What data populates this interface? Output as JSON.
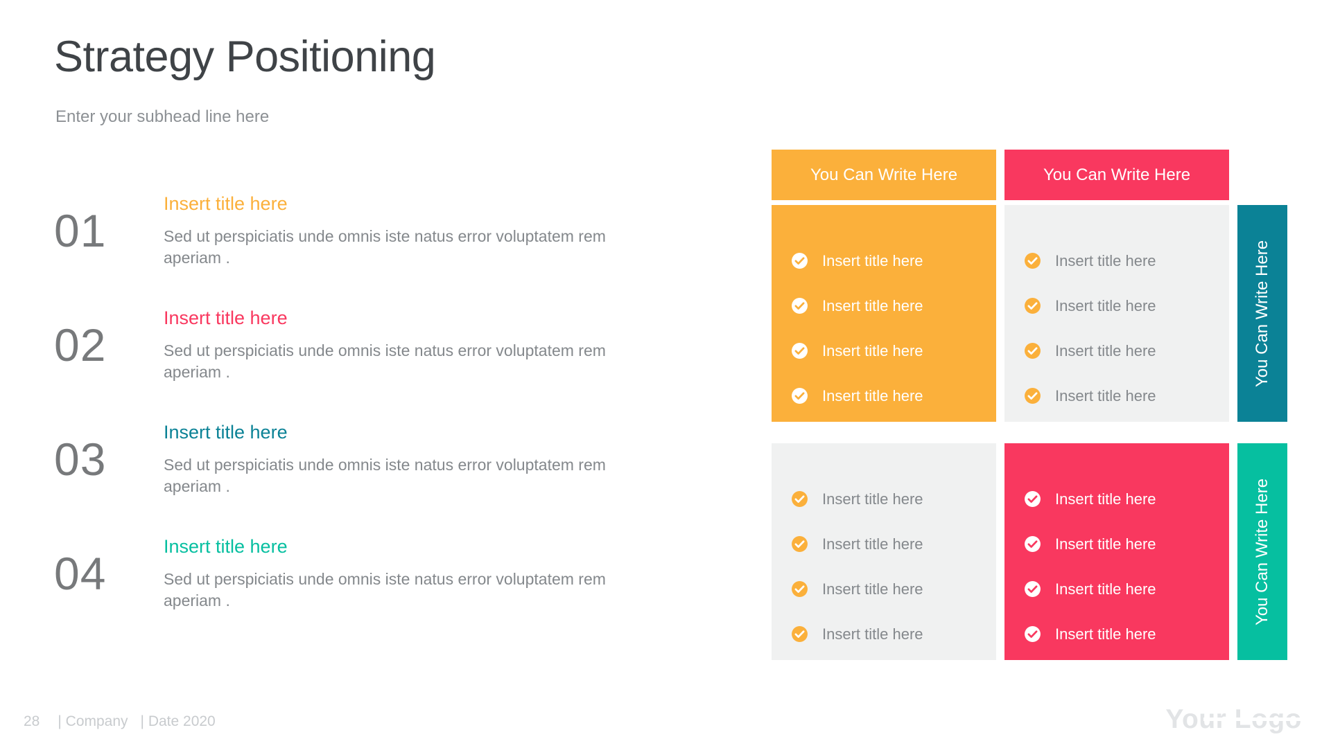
{
  "header": {
    "title": "Strategy Positioning",
    "subhead": "Enter your subhead line here"
  },
  "colors": {
    "orange": "#fbb03b",
    "pink": "#f9385f",
    "teal_dark": "#0b8296",
    "teal_bright": "#06bfa0",
    "gray_panel": "#f0f1f1",
    "text_gray": "#84888c",
    "number_gray": "#77797b",
    "title_dark": "#3f4347",
    "footer_gray": "#c8cbce",
    "white": "#ffffff"
  },
  "steps": [
    {
      "number": "01",
      "title": "Insert title here",
      "color": "#fbb03b",
      "description": "Sed ut perspiciatis unde omnis iste natus error voluptatem rem aperiam ."
    },
    {
      "number": "02",
      "title": "Insert title here",
      "color": "#f9385f",
      "description": "Sed ut perspiciatis unde omnis iste natus error voluptatem rem aperiam ."
    },
    {
      "number": "03",
      "title": "Insert title here",
      "color": "#0b8296",
      "description": "Sed ut perspiciatis unde omnis iste natus error voluptatem rem aperiam ."
    },
    {
      "number": "04",
      "title": "Insert title here",
      "color": "#06bfa0",
      "description": "Sed ut perspiciatis unde omnis iste natus error voluptatem rem aperiam ."
    }
  ],
  "matrix": {
    "column_headers": [
      {
        "label": "You Can Write Here",
        "bg": "#fbb03b",
        "text": "#ffffff"
      },
      {
        "label": "You Can Write Here",
        "bg": "#f9385f",
        "text": "#ffffff"
      }
    ],
    "row_labels": [
      {
        "label": "You Can Write Here",
        "bg": "#0b8296",
        "text": "#ffffff"
      },
      {
        "label": "You Can Write Here",
        "bg": "#06bfa0",
        "text": "#ffffff"
      }
    ],
    "cells": [
      {
        "id": "r0c0",
        "bg": "#fbb03b",
        "icon_fill": "#ffffff",
        "icon_check": "#fbb03b",
        "text": "#ffffff",
        "icon_name": "check-circle-icon",
        "items": [
          "Insert title here",
          "Insert title here",
          "Insert title here",
          "Insert title here"
        ]
      },
      {
        "id": "r0c1",
        "bg": "#f0f1f1",
        "icon_fill": "#fbb03b",
        "icon_check": "#ffffff",
        "text": "#84888c",
        "icon_name": "check-circle-icon",
        "items": [
          "Insert title here",
          "Insert title here",
          "Insert title here",
          "Insert title here"
        ]
      },
      {
        "id": "r1c0",
        "bg": "#f0f1f1",
        "icon_fill": "#fbb03b",
        "icon_check": "#ffffff",
        "text": "#84888c",
        "icon_name": "check-circle-icon",
        "items": [
          "Insert title here",
          "Insert title here",
          "Insert title here",
          "Insert title here"
        ]
      },
      {
        "id": "r1c1",
        "bg": "#f9385f",
        "icon_fill": "#ffffff",
        "icon_check": "#f9385f",
        "text": "#ffffff",
        "icon_name": "check-circle-icon",
        "items": [
          "Insert title here",
          "Insert title here",
          "Insert title here",
          "Insert title here"
        ]
      }
    ]
  },
  "footer": {
    "page_number": "28",
    "company": "| Company",
    "date": "| Date 2020",
    "logo": "Your Logo"
  }
}
